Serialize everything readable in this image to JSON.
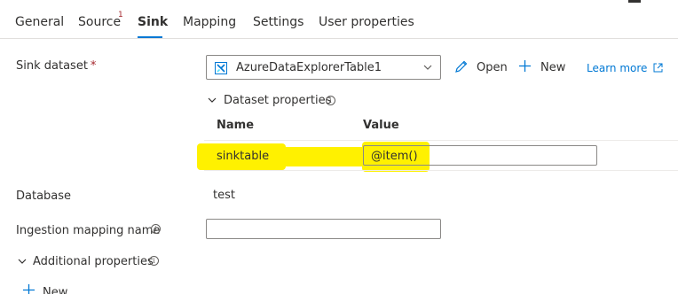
{
  "tabs": [
    {
      "label": "General"
    },
    {
      "label": "Source",
      "badge": "1"
    },
    {
      "label": "Sink"
    },
    {
      "label": "Mapping"
    },
    {
      "label": "Settings"
    },
    {
      "label": "User properties"
    }
  ],
  "sink_dataset": {
    "label": "Sink dataset",
    "required_mark": "*",
    "selected_value": "AzureDataExplorerTable1",
    "open_label": "Open",
    "new_label": "New",
    "learn_more_label": "Learn more"
  },
  "dataset_properties": {
    "label": "Dataset properties",
    "name_header": "Name",
    "value_header": "Value",
    "rows": [
      {
        "name": "sinktable",
        "value": "@item()"
      }
    ]
  },
  "database": {
    "label": "Database",
    "value": "test"
  },
  "ingestion_mapping": {
    "label": "Ingestion mapping name",
    "value": ""
  },
  "additional_properties": {
    "label": "Additional properties",
    "new_label": "New"
  },
  "colors": {
    "accent": "#0078d4",
    "highlight": "#fff100",
    "required": "#a4262c"
  }
}
